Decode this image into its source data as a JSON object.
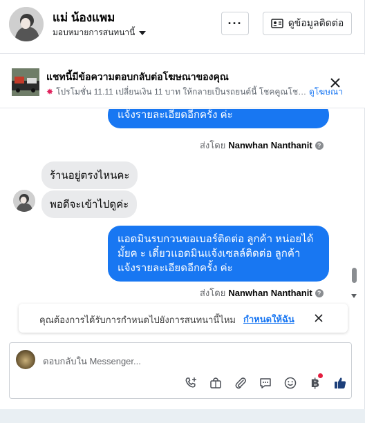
{
  "header": {
    "contact_name": "แม่ น้องแพม",
    "assign_label": "มอบหมายการสนทนานี้",
    "more_label": "···",
    "contact_info_label": "ดูข้อมูลติดต่อ"
  },
  "ad_banner": {
    "title": "แชทนี้มีข้อความตอบกลับต่อโฆษณาของคุณ",
    "subtitle": "โปรโมชั่น 11.11 เปลี่ยนเงิน 11 บาท ให้กลายเป็นรถยนต์นี้ โชคคูณโชค จั...",
    "link_label": "ดูโฆษณา"
  },
  "messages": {
    "outgoing_1_line1": "แจ้งรายละเอียดอีกครั้ง ค่ะ",
    "sent_by_prefix_1": "ส่งโดย",
    "sent_by_name_1": "Nanwhan Nanthanit",
    "incoming_1": "ร้านอยู่ตรงไหนคะ",
    "incoming_2": "พอดีจะเข้าไปดูค่ะ",
    "outgoing_2_line1": "แอดมินรบกวนขอเบอร์ติดต่อ ลูกค้า  หน่อยได้",
    "outgoing_2_line2": "มั้ยค ะ เดี๋ยวแอดมินแจ้งเซลล์ติดต่อ ลูกค้า",
    "outgoing_2_line3": "แจ้งรายละเอียดอีกครั้ง ค่ะ",
    "sent_by_prefix_2": "ส่งโดย",
    "sent_by_name_2": "Nanwhan Nanthanit"
  },
  "assign_prompt": {
    "text": "คุณต้องการได้รับการกำหนดไปยังการสนทนานี้ไหม",
    "link_label": "กำหนดให้ฉัน"
  },
  "composer": {
    "placeholder": "ตอบกลับใน Messenger...",
    "baht_symbol": "฿"
  },
  "colors": {
    "accent": "#1877f2",
    "bubble_incoming": "#e9eaec",
    "notification_dot": "#e41e3f"
  },
  "icons": [
    "more-dots-icon",
    "contact-card-icon",
    "close-icon",
    "call-add-icon",
    "shopping-bag-icon",
    "attachment-icon",
    "chat-reply-icon",
    "emoji-icon",
    "baht-icon",
    "thumbs-up-icon"
  ]
}
